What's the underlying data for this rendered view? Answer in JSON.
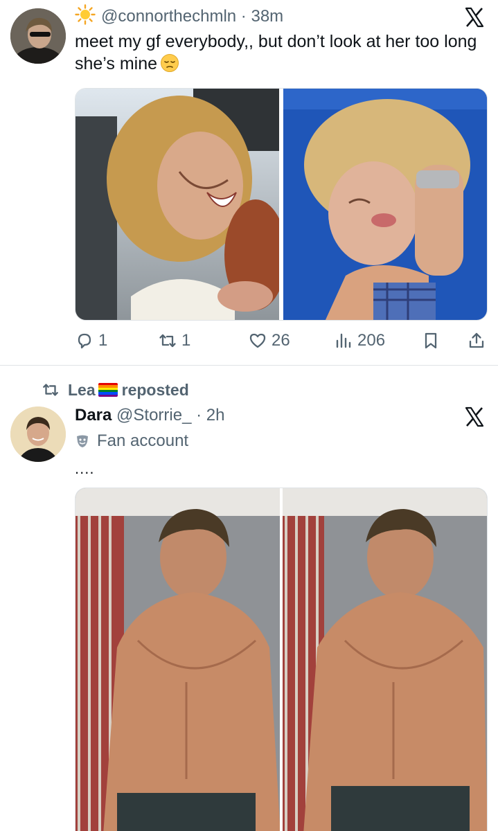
{
  "tweet1": {
    "handle": "@connorthechmln",
    "time": "38m",
    "text": "meet my gf everybody,, but don’t look at her too long she’s mine",
    "emoji": "pensive-face-emoji",
    "icons": {
      "sun": "sun-icon",
      "brand": "x-logo-icon"
    },
    "actions": {
      "replies": "1",
      "reposts": "1",
      "likes": "26",
      "views": "206"
    }
  },
  "tweet2": {
    "repost_user": "Lea",
    "repost_flag": "rainbow-flag-icon",
    "repost_label": "reposted",
    "display_name": "Dara",
    "handle": "@Storrie_",
    "time": "2h",
    "account_label": "Fan account",
    "text": "....",
    "icons": {
      "brand": "x-logo-icon",
      "label": "theater-masks-icon"
    }
  },
  "colors": {
    "text_primary": "#0f1419",
    "text_secondary": "#536471",
    "divider": "#dfe3e6",
    "background": "#ffffff"
  }
}
